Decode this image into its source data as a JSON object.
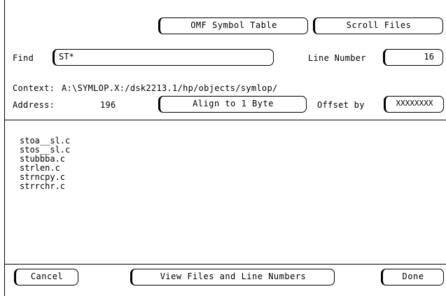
{
  "header": {
    "omf_button": "OMF Symbol Table",
    "scroll_button": "Scroll Files"
  },
  "find": {
    "label": "Find",
    "value": "ST*"
  },
  "line_number": {
    "label": "Line Number",
    "value": "16"
  },
  "context": {
    "label": "Context:",
    "value": "A:\\SYMLOP.X:/dsk2213.1/hp/objects/symlop/"
  },
  "address": {
    "label": "Address:",
    "value": "196",
    "align_button": "Align to 1 Byte",
    "offset_label": "Offset by",
    "offset_value": "XXXXXXXX"
  },
  "files": [
    "stoa__sl.c",
    "stos__sl.c",
    "stubbba.c",
    "strlen.c",
    "strncpy.c",
    "strrchr.c"
  ],
  "footer": {
    "cancel": "Cancel",
    "view": "View Files and Line Numbers",
    "done": "Done"
  }
}
